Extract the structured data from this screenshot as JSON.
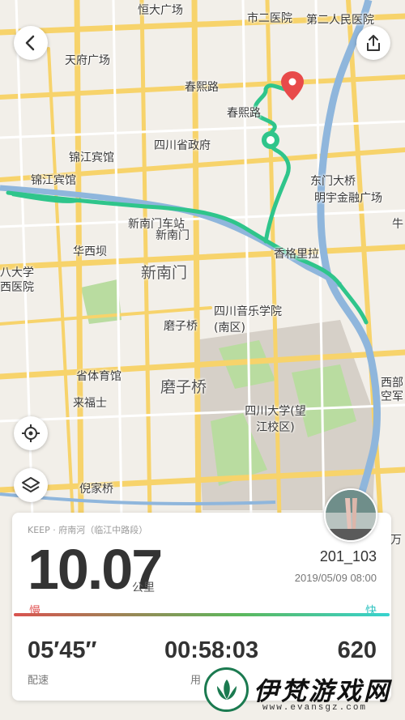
{
  "map": {
    "labels": [
      "恒大广场",
      "市二医院",
      "第二人民医院",
      "天府广场",
      "春熙路",
      "春熙路",
      "四川省政府",
      "锦江宾馆",
      "锦江宾馆",
      "东门大桥",
      "明宇金融广场",
      "新南门车站",
      "新南门",
      "华西坝",
      "新南门",
      "八大学",
      "西医院",
      "香格里拉",
      "四川音乐学院(南区)",
      "磨子桥",
      "省体育馆",
      "磨子桥",
      "来福士",
      "四川大学(望江校区)",
      "倪家桥",
      "西部",
      "空军",
      "万",
      "牛"
    ]
  },
  "buttons": {
    "back_icon": "chevron-left-icon",
    "share_icon": "share-icon",
    "locate_icon": "locate-icon",
    "layers_icon": "layers-icon"
  },
  "card": {
    "source": "KEEP · 府南河（临江中路段）",
    "distance": "10.07",
    "distance_unit": "公里",
    "username": "201_103",
    "datetime": "2019/05/09 08:00",
    "speed_slow": "慢",
    "speed_fast": "快",
    "pace": "05′45″",
    "pace_label": "配速",
    "duration": "00:58:03",
    "duration_label": "用",
    "calories": "620"
  },
  "watermark": {
    "brand": "伊梵游戏网",
    "url": "www.evansgz.com"
  },
  "colors": {
    "route": "#2fc58b",
    "river": "#8fb6dc",
    "road": "#f7d36b",
    "end_pin": "#e84a4a"
  }
}
